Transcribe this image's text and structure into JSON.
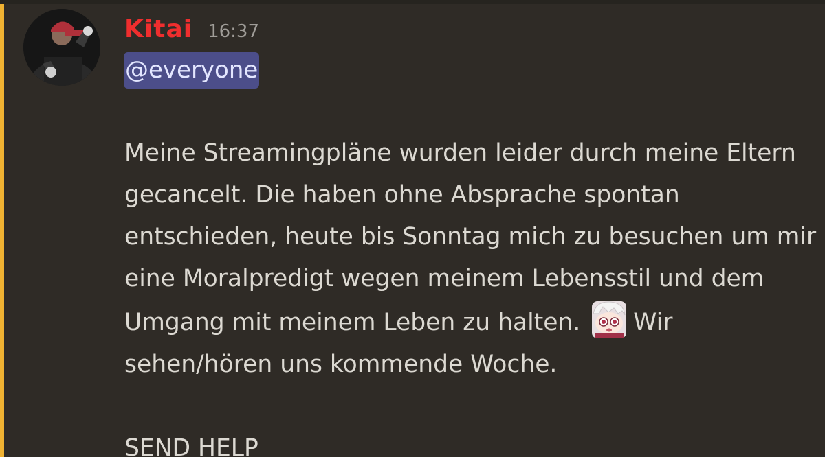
{
  "message": {
    "author": "Kitai",
    "timestamp": "16:37",
    "mention": "@everyone",
    "body_part1": "Meine Streamingpläne wurden leider durch meine Eltern gecancelt. Die haben ohne Absprache spontan entschieden, heute bis Sonntag mich zu besuchen um mir eine Moralpredigt wegen meinem Lebensstil und dem Umgang mit meinem Leben zu halten.",
    "body_part2": "Wir sehen/hören uns kommende Woche.",
    "body_last": "SEND HELP",
    "emoji_name": "worried-anime-character-emoji",
    "avatar_icon": "user-avatar-photo"
  },
  "colors": {
    "background": "#2f2b26",
    "highlight_bar": "#f0b232",
    "author": "#ef2e2e",
    "mention_bg": "#4c4e8a",
    "mention_text": "#e3e6ff",
    "text": "#dcd9d2",
    "timestamp": "#a09d98"
  }
}
